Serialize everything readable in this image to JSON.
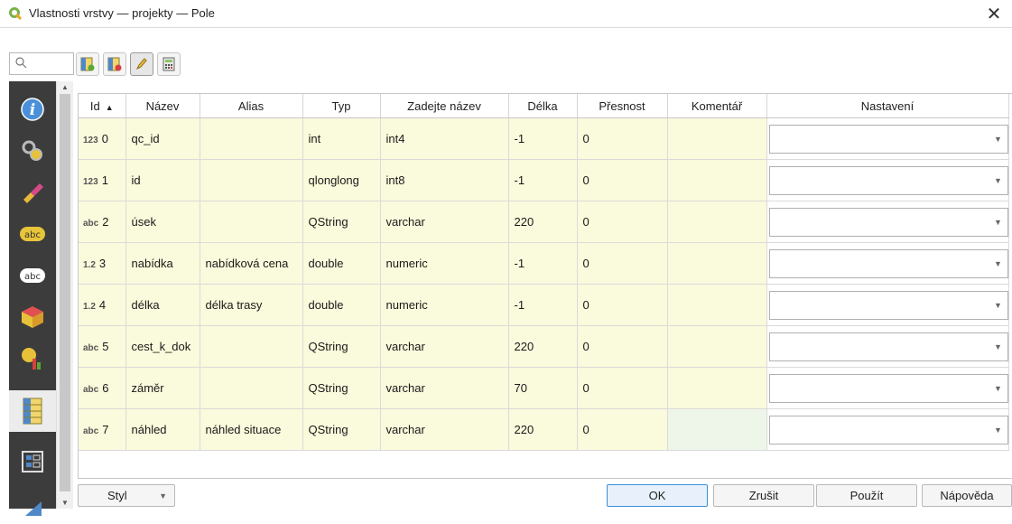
{
  "window": {
    "title": "Vlastnosti vrstvy — projekty — Pole",
    "close": "✕"
  },
  "search": {
    "placeholder": ""
  },
  "toolbar": {
    "buttons": [
      {
        "icon": "new-field-icon"
      },
      {
        "icon": "delete-field-icon"
      },
      {
        "icon": "edit-mode-pencil-icon"
      },
      {
        "icon": "field-calculator-icon"
      }
    ]
  },
  "sidebar": {
    "items": [
      "information-icon",
      "source-settings-icon",
      "symbology-icon",
      "labels-icon",
      "masks-labels-icon",
      "3d-view-icon",
      "diagrams-icon",
      "fields-icon",
      "attributes-form-icon",
      "joins-icon"
    ]
  },
  "table": {
    "headers": [
      "Id",
      "Název",
      "Alias",
      "Typ",
      "Zadejte název",
      "Délka",
      "Přesnost",
      "Komentář",
      "Nastavení"
    ],
    "sort_indicator": "▲",
    "rows": [
      {
        "glyph": "123",
        "id": "0",
        "name": "qc_id",
        "alias": "",
        "type": "int",
        "type_name": "int4",
        "length": "-1",
        "precision": "0",
        "comment": ""
      },
      {
        "glyph": "123",
        "id": "1",
        "name": "id",
        "alias": "",
        "type": "qlonglong",
        "type_name": "int8",
        "length": "-1",
        "precision": "0",
        "comment": ""
      },
      {
        "glyph": "abc",
        "id": "2",
        "name": "úsek",
        "alias": "",
        "type": "QString",
        "type_name": "varchar",
        "length": "220",
        "precision": "0",
        "comment": ""
      },
      {
        "glyph": "1.2",
        "id": "3",
        "name": "nabídka",
        "alias": "nabídková cena",
        "type": "double",
        "type_name": "numeric",
        "length": "-1",
        "precision": "0",
        "comment": ""
      },
      {
        "glyph": "1.2",
        "id": "4",
        "name": "délka",
        "alias": "délka trasy",
        "type": "double",
        "type_name": "numeric",
        "length": "-1",
        "precision": "0",
        "comment": ""
      },
      {
        "glyph": "abc",
        "id": "5",
        "name": "cest_k_dok",
        "alias": "",
        "type": "QString",
        "type_name": "varchar",
        "length": "220",
        "precision": "0",
        "comment": ""
      },
      {
        "glyph": "abc",
        "id": "6",
        "name": "záměr",
        "alias": "",
        "type": "QString",
        "type_name": "varchar",
        "length": "70",
        "precision": "0",
        "comment": ""
      },
      {
        "glyph": "abc",
        "id": "7",
        "name": "náhled",
        "alias": "náhled situace",
        "type": "QString",
        "type_name": "varchar",
        "length": "220",
        "precision": "0",
        "comment": ""
      }
    ]
  },
  "footer": {
    "style_label": "Styl",
    "ok": "OK",
    "cancel": "Zrušit",
    "apply": "Použít",
    "help": "Nápověda"
  }
}
